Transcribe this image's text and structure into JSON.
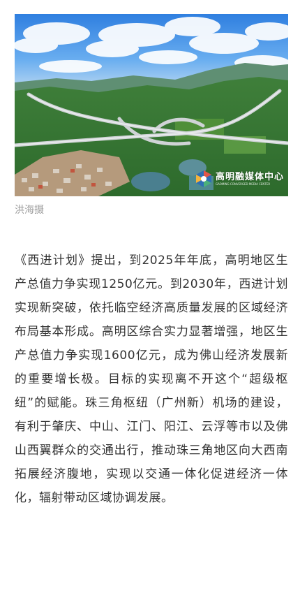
{
  "photo": {
    "alt": "Aerial view of highway interchange among green hills near a village",
    "watermark_cn": "高明融媒体中心",
    "watermark_en": "GAOMING CONVERGED MEDIA CENTER"
  },
  "caption": "洪海摄",
  "article": {
    "paragraph": "《西进计划》提出，到2025年年底，高明地区生产总值力争实现1250亿元。到2030年，西进计划实现新突破，依托临空经济高质量发展的区域经济布局基本形成。高明区综合实力显著增强，地区生产总值力争实现1600亿元，成为佛山经济发展新的重要增长极。目标的实现离不开这个“超级枢纽”的赋能。珠三角枢纽（广州新）机场的建设，有利于肇庆、中山、江门、阳江、云浮等市以及佛山西翼群众的交通出行，推动珠三角地区向大西南拓展经济腹地，实现以交通一体化促进经济一体化，辐射带动区域协调发展。"
  }
}
